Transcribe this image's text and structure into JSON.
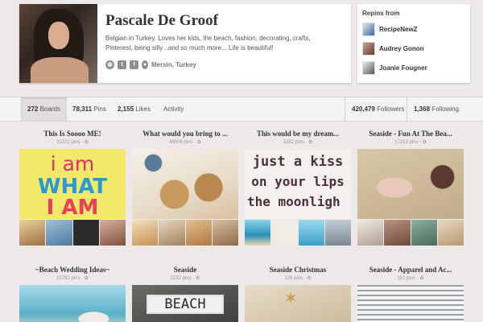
{
  "profile": {
    "name": "Pascale De Groof",
    "bio": "Belgian in Turkey. Loves her kids, the beach, fashion, decorating, crafts, Pinterest, being silly ..and so much more... Life is beautiful!",
    "location": "Mersin, Turkey",
    "icons": [
      "globe-icon",
      "twitter-icon",
      "facebook-icon",
      "location-pin-icon"
    ]
  },
  "repins": {
    "title": "Repins from",
    "users": [
      {
        "name": "RecipeNewZ",
        "color": "#3a6a9a"
      },
      {
        "name": "Audrey Gonon",
        "color": "#8a5a4a"
      },
      {
        "name": "Joanie Fougner",
        "color": "#5a5a5a"
      }
    ]
  },
  "stats": {
    "boards_count": "272",
    "boards_label": "Boards",
    "pins_count": "78,311",
    "pins_label": "Pins",
    "likes_count": "2,155",
    "likes_label": "Likes",
    "activity_label": "Activity",
    "followers_count": "420,479",
    "followers_label": "Followers",
    "following_count": "1,368",
    "following_label": "Following"
  },
  "boards": [
    {
      "title": "This Is Soooo ME!",
      "pins": "22222 pins",
      "cover_lines": [
        "i am",
        "WHAT",
        "I AM"
      ],
      "thumbs": [
        "#c9a070",
        "#7aa0c0",
        "#2a2a2a",
        "#b08070"
      ]
    },
    {
      "title": "What would you bring to ...",
      "pins": "48006 pins",
      "thumbs": [
        "#d4b080",
        "#c8a878",
        "#c09060",
        "#b89070"
      ]
    },
    {
      "title": "This would be my dream...",
      "pins": "3282 pins",
      "cover_lines": [
        "just a kiss",
        "on your lips",
        "the moonligh"
      ],
      "thumbs": [
        "#4aa0c0",
        "#e8e0d0",
        "#6ab0d0",
        "#a0b0b8"
      ]
    },
    {
      "title": "Seaside - Fun At The Bea...",
      "pins": "17253 pins",
      "thumbs": [
        "#c8b8a0",
        "#8a6a5a",
        "#6a8a7a",
        "#c0a890"
      ]
    },
    {
      "title": "~Beach Wedding Ideas~",
      "pins": "10792 pins"
    },
    {
      "title": "Seaside",
      "pins": "2152 pins",
      "cover_lines": [
        "BEACH"
      ]
    },
    {
      "title": "Seaside Christmas",
      "pins": "126 pins"
    },
    {
      "title": "Seaside - Apparel and Ac...",
      "pins": "321 pins"
    }
  ]
}
